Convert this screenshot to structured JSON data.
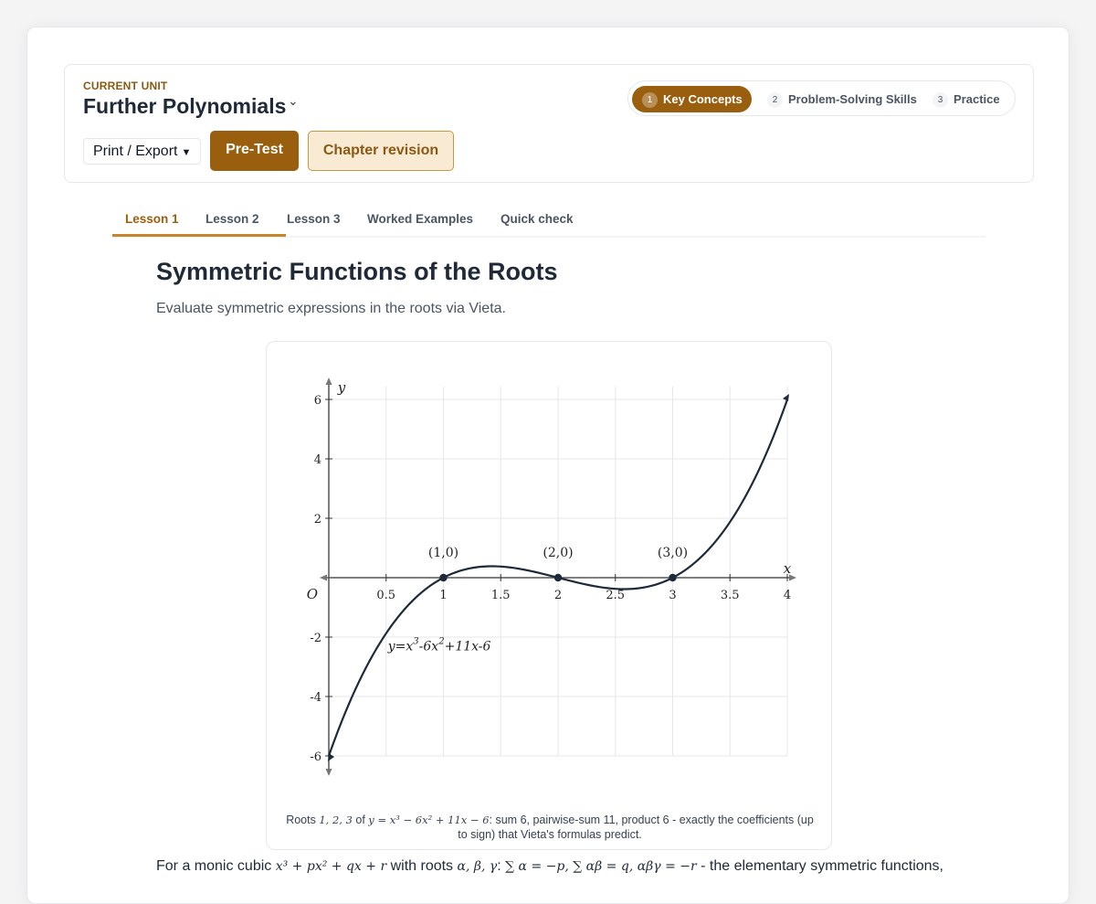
{
  "unit": {
    "label": "CURRENT UNIT",
    "title": "Further Polynomials",
    "chevron": "⌄"
  },
  "actions": {
    "print_label": "Print / Export",
    "pretest_label": "Pre-Test",
    "revision_label": "Chapter revision"
  },
  "steps": [
    {
      "num": "1",
      "label": "Key Concepts",
      "active": true
    },
    {
      "num": "2",
      "label": "Problem-Solving Skills",
      "active": false
    },
    {
      "num": "3",
      "label": "Practice",
      "active": false
    }
  ],
  "tabs": [
    {
      "label": "Lesson 1",
      "active": true
    },
    {
      "label": "Lesson 2",
      "active": false
    },
    {
      "label": "Lesson 3",
      "active": false
    },
    {
      "label": "Worked Examples",
      "active": false
    },
    {
      "label": "Quick check",
      "active": false
    }
  ],
  "lesson": {
    "title": "Symmetric Functions of the Roots",
    "subtitle": "Evaluate symmetric expressions in the roots via Vieta."
  },
  "chart_data": {
    "type": "line",
    "function": "y=x^3-6x^2+11x-6",
    "equation_label": "y=x3-6x2+11x-6",
    "xlabel": "x",
    "ylabel": "y",
    "origin_label": "O",
    "xlim": [
      0,
      4
    ],
    "ylim": [
      -6,
      6
    ],
    "x_ticks": [
      0.5,
      1,
      1.5,
      2,
      2.5,
      3,
      3.5,
      4
    ],
    "x_tick_labels": [
      "0.5",
      "1",
      "1.5",
      "2",
      "2.5",
      "3",
      "3.5",
      "4"
    ],
    "y_ticks": [
      -6,
      -4,
      -2,
      2,
      4,
      6
    ],
    "y_tick_labels": [
      "-6",
      "-4",
      "-2",
      "2",
      "4",
      "6"
    ],
    "grid": true,
    "points": [
      {
        "x": 1,
        "y": 0,
        "label": "(1,0)"
      },
      {
        "x": 2,
        "y": 0,
        "label": "(2,0)"
      },
      {
        "x": 3,
        "y": 0,
        "label": "(3,0)"
      }
    ]
  },
  "caption": {
    "prefix": "Roots ",
    "roots": "1, 2, 3",
    "of": " of ",
    "equation": "y = x³ − 6x² + 11x − 6",
    "rest": ": sum 6, pairwise-sum 11, product 6 - exactly the coefficients (up to sign) that Vieta's formulas predict."
  },
  "body": {
    "intro": "For a monic cubic ",
    "poly": "x³ + px² + qx + r",
    "with_roots": " with roots ",
    "roots": "α, β, γ",
    "colon": ": ",
    "relations": "∑ α = −p, ∑ αβ = q, αβγ = −r",
    "tail": " - the elementary symmetric functions,"
  },
  "colors": {
    "accent": "#9a5f0e",
    "accent_light": "#f9ead4",
    "tab_underline": "#c8862a",
    "curve": "#1e2a3a"
  }
}
